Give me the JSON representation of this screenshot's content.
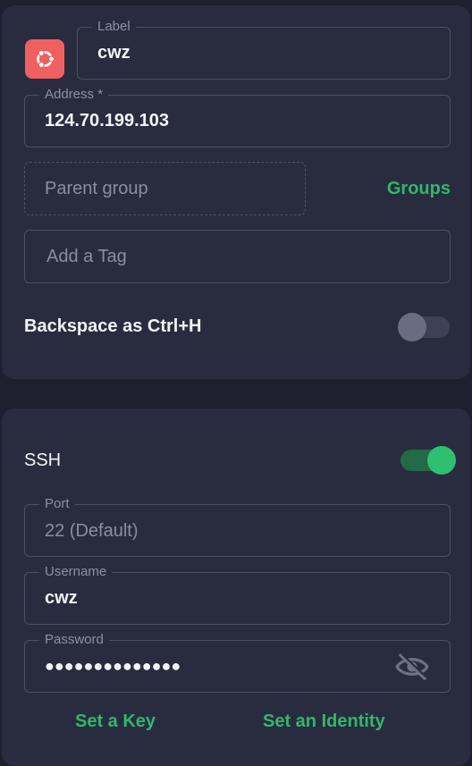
{
  "colors": {
    "background": "#1e2030",
    "card": "#292c3e",
    "accent_green": "#2fb86a",
    "os_icon_bg": "#f06060"
  },
  "general": {
    "os_icon": "ubuntu-icon",
    "label": {
      "legend": "Label",
      "value": "cwz"
    },
    "address": {
      "legend": "Address *",
      "value": "124.70.199.103"
    },
    "parent_group": {
      "placeholder": "Parent group"
    },
    "groups_link": "Groups",
    "tag": {
      "placeholder": "Add a Tag"
    },
    "backspace": {
      "label": "Backspace as Ctrl+H",
      "enabled": false
    }
  },
  "ssh": {
    "label": "SSH",
    "enabled": true,
    "port": {
      "legend": "Port",
      "value": "22 (Default)"
    },
    "username": {
      "legend": "Username",
      "value": "cwz"
    },
    "password": {
      "legend": "Password",
      "value": "●●●●●●●●●●●●●●",
      "visibility_icon": "eye-off-icon"
    },
    "set_key": "Set a Key",
    "set_identity": "Set an Identity"
  }
}
